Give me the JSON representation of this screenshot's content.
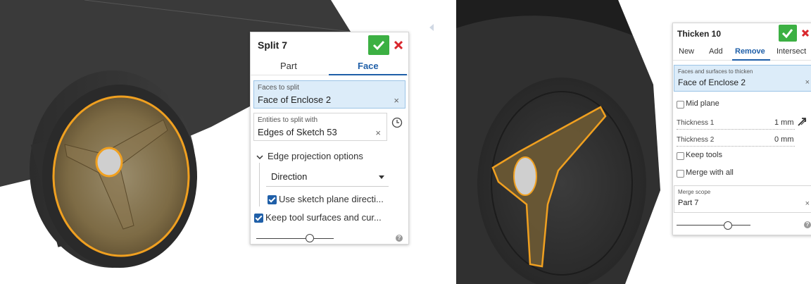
{
  "colors": {
    "accent": "#1f5fa8",
    "confirm": "#3cb043",
    "cancel": "#d9262c",
    "selection_bg": "#dcecf9",
    "highlight_edge": "#f0a020"
  },
  "split_panel": {
    "title": "Split 7",
    "tabs": [
      {
        "label": "Part",
        "active": false
      },
      {
        "label": "Face",
        "active": true
      }
    ],
    "faces_field": {
      "label": "Faces to split",
      "value": "Face of Enclose 2",
      "clear": "×"
    },
    "entities_field": {
      "label": "Entities to split with",
      "value": "Edges of Sketch 53",
      "clear": "×"
    },
    "edge_projection_label": "Edge projection options",
    "direction_select": {
      "value": "Direction"
    },
    "use_sketch_plane": {
      "label": "Use sketch plane directi...",
      "checked": true
    },
    "keep_tool_surfaces": {
      "label": "Keep tool surfaces and cur...",
      "checked": true
    },
    "help_icon": "?"
  },
  "thicken_panel": {
    "title": "Thicken 10",
    "tabs": [
      {
        "label": "New",
        "active": false
      },
      {
        "label": "Add",
        "active": false
      },
      {
        "label": "Remove",
        "active": true
      },
      {
        "label": "Intersect",
        "active": false
      }
    ],
    "faces_field": {
      "label": "Faces and surfaces to thicken",
      "value": "Face of Enclose 2",
      "clear": "×"
    },
    "mid_plane": {
      "label": "Mid plane",
      "checked": false
    },
    "thickness1": {
      "label": "Thickness 1",
      "value": "1 mm"
    },
    "thickness2": {
      "label": "Thickness 2",
      "value": "0 mm"
    },
    "keep_tools": {
      "label": "Keep tools",
      "checked": false
    },
    "merge_with_all": {
      "label": "Merge with all",
      "checked": false
    },
    "merge_scope": {
      "label": "Merge scope",
      "value": "Part 7",
      "clear": "×"
    },
    "help_icon": "?"
  }
}
